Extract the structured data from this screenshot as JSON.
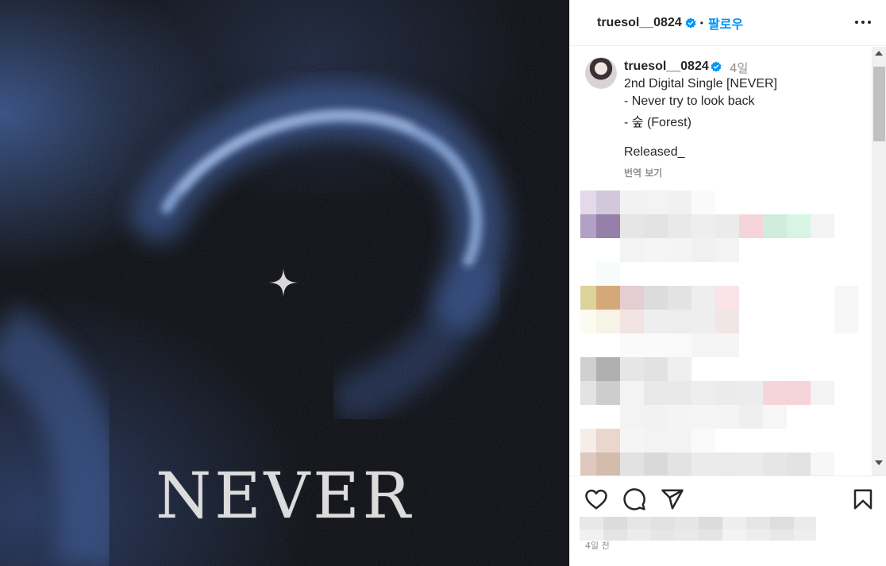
{
  "post": {
    "image_title": "NEVER",
    "author": "truesol__0824",
    "follow_label": "팔로우",
    "separator": "•",
    "caption": {
      "time": "4일",
      "lines": [
        "2nd Digital Single [NEVER]",
        "- Never try to look back",
        "- 숲 (Forest)",
        "",
        "Released_"
      ],
      "translate_label": "번역 보기"
    },
    "post_time": "4일 전"
  },
  "icons": {
    "verified": "verified-badge-icon",
    "more": "more-options-icon",
    "like": "heart-icon",
    "comment": "comment-bubble-icon",
    "share": "paper-plane-icon",
    "save": "bookmark-icon",
    "sparkle": "sparkle-star-icon"
  },
  "colors": {
    "accent": "#0095f6",
    "verified": "#0095f6",
    "muted": "#8e8e8e",
    "text": "#262626"
  }
}
